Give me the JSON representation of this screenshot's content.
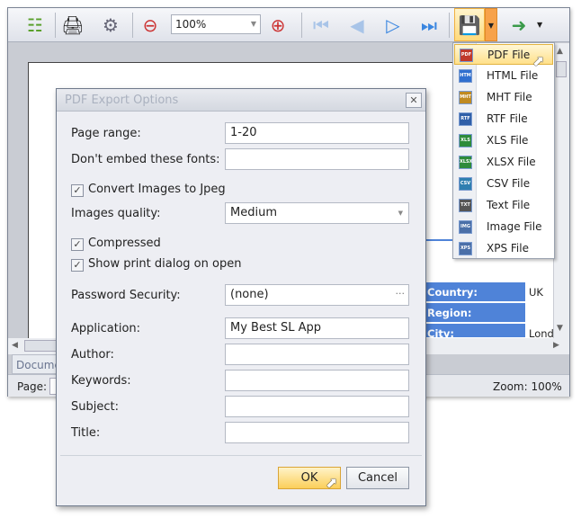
{
  "toolbar": {
    "zoom_value": "100%",
    "icons": [
      "document-map-icon",
      "print-icon",
      "page-setup-icon",
      "zoom-out-icon",
      "zoom-in-icon",
      "first-page-icon",
      "previous-page-icon",
      "next-page-icon",
      "last-page-icon",
      "export-icon",
      "export-to-window-icon"
    ]
  },
  "export_menu": {
    "items": [
      {
        "label": "PDF File",
        "icon": "PDF",
        "color": "#c0392b"
      },
      {
        "label": "HTML File",
        "icon": "HTM",
        "color": "#2f6fcf"
      },
      {
        "label": "MHT File",
        "icon": "MHT",
        "color": "#c08a20"
      },
      {
        "label": "RTF File",
        "icon": "RTF",
        "color": "#2f5fa8"
      },
      {
        "label": "XLS File",
        "icon": "XLS",
        "color": "#2e8b3a"
      },
      {
        "label": "XLSX File",
        "icon": "XLSX",
        "color": "#2e8b3a"
      },
      {
        "label": "CSV File",
        "icon": "CSV",
        "color": "#2f7fb0"
      },
      {
        "label": "Text File",
        "icon": "TXT",
        "color": "#555555"
      },
      {
        "label": "Image File",
        "icon": "IMG",
        "color": "#4a6fa8"
      },
      {
        "label": "XPS File",
        "icon": "XPS",
        "color": "#4a6fa8"
      }
    ]
  },
  "report": {
    "rows": [
      {
        "label": "Country:",
        "value": "UK"
      },
      {
        "label": "Region:",
        "value": ""
      },
      {
        "label": "City:",
        "value": "Londo"
      }
    ]
  },
  "doc_tab": "Docume",
  "status": {
    "page_label": "Page:",
    "zoom": "Zoom: 100%"
  },
  "dialog": {
    "title": "PDF Export Options",
    "page_range_label": "Page range:",
    "page_range": "1-20",
    "fonts_label": "Don't embed these fonts:",
    "fonts": "",
    "convert_images_label": "Convert Images to Jpeg",
    "convert_images": true,
    "images_quality_label": "Images quality:",
    "images_quality": "Medium",
    "compressed_label": "Compressed",
    "compressed": true,
    "show_print_label": "Show print dialog on open",
    "show_print": true,
    "password_label": "Password Security:",
    "password": "(none)",
    "ellipsis": "···",
    "application_label": "Application:",
    "application": "My Best SL App",
    "author_label": "Author:",
    "author": "",
    "keywords_label": "Keywords:",
    "keywords": "",
    "subject_label": "Subject:",
    "subject": "",
    "title_label": "Title:",
    "title_value": "",
    "ok": "OK",
    "cancel": "Cancel"
  }
}
